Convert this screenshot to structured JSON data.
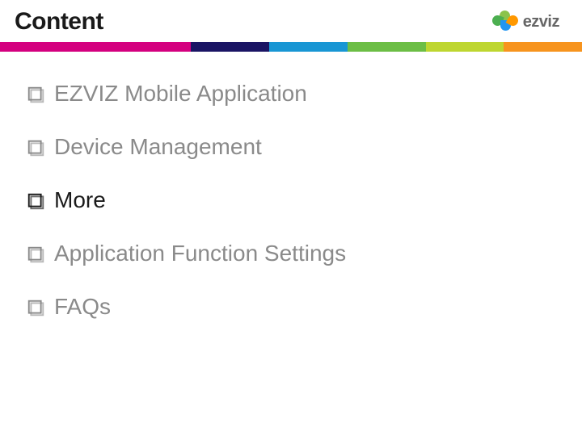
{
  "header": {
    "title": "Content",
    "brand": "ezviz"
  },
  "colorbar": [
    "#d4007f",
    "#1a1464",
    "#1896d4",
    "#6cbe45",
    "#bed630",
    "#f7941e"
  ],
  "items": [
    {
      "label": "EZVIZ Mobile Application",
      "active": false
    },
    {
      "label": "Device Management",
      "active": false
    },
    {
      "label": "More",
      "active": true
    },
    {
      "label": "Application Function Settings",
      "active": false
    },
    {
      "label": "FAQs",
      "active": false
    }
  ]
}
